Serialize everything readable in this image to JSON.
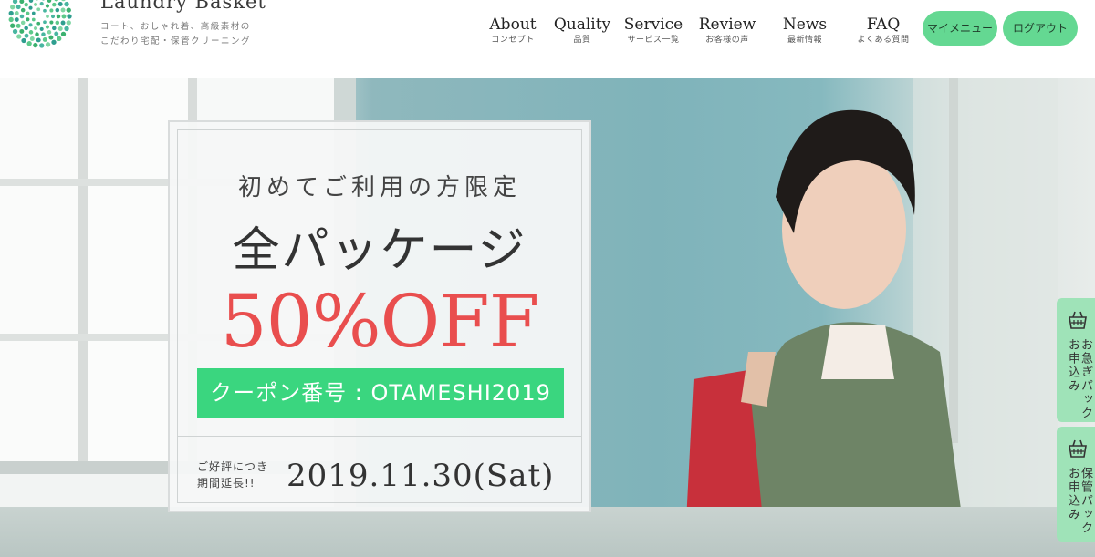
{
  "header": {
    "logo_text": "Laundry  Basket",
    "tagline_1": "コート、おしゃれ着、高級素材の",
    "tagline_2": "こだわり宅配・保管クリーニング"
  },
  "nav": [
    {
      "en": "About",
      "jp": "コンセプト"
    },
    {
      "en": "Quality",
      "jp": "品質"
    },
    {
      "en": "Service",
      "jp": "サービス一覧"
    },
    {
      "en": "Review",
      "jp": "お客様の声"
    },
    {
      "en": "News",
      "jp": "最新情報"
    },
    {
      "en": "FAQ",
      "jp": "よくある質問"
    }
  ],
  "buttons": {
    "mymenu": "マイメニュー",
    "logout": "ログアウト"
  },
  "promo": {
    "lead": "初めてご利用の方限定",
    "main": "全パッケージ",
    "discount": "50%OFF",
    "coupon": "クーポン番号 : OTAMESHI2019",
    "extend_1": "ご好評につき",
    "extend_2": "期間延長!!",
    "date": "2019.11.30(Sat)"
  },
  "side_tabs": {
    "express": "お急ぎパック お申込み",
    "storage": "保管パック お申込み"
  },
  "colors": {
    "accent_green": "#64d892",
    "coupon_green": "#3ad67f",
    "discount_red": "#e94e4e",
    "side_tab_green": "#9fe3b8"
  }
}
